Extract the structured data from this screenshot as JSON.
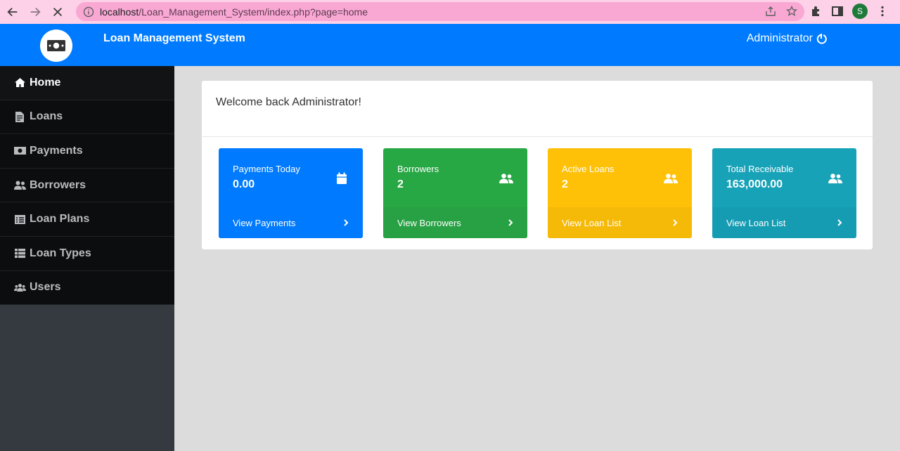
{
  "browser": {
    "url_host": "localhost",
    "url_path": "/Loan_Management_System/index.php?page=home",
    "profile_initial": "S"
  },
  "header": {
    "title": "Loan Management System",
    "user": "Administrator"
  },
  "sidebar": {
    "items": [
      {
        "label": "Home",
        "icon": "home-icon"
      },
      {
        "label": "Loans",
        "icon": "file-invoice-icon"
      },
      {
        "label": "Payments",
        "icon": "money-bill-icon"
      },
      {
        "label": "Borrowers",
        "icon": "user-friends-icon"
      },
      {
        "label": "Loan Plans",
        "icon": "list-alt-icon"
      },
      {
        "label": "Loan Types",
        "icon": "th-list-icon"
      },
      {
        "label": "Users",
        "icon": "users-icon"
      }
    ]
  },
  "main": {
    "welcome": "Welcome back Administrator!",
    "tiles": [
      {
        "label": "Payments Today",
        "value": "0.00",
        "link": "View Payments",
        "color": "#007bff",
        "footer_color": "#007bff",
        "icon": "calendar-icon"
      },
      {
        "label": "Borrowers",
        "value": "2",
        "link": "View Borrowers",
        "color": "#28a745",
        "footer_color": "#27a143",
        "icon": "user-friends-icon"
      },
      {
        "label": "Active Loans",
        "value": "2",
        "link": "View Loan List",
        "color": "#ffc107",
        "footer_color": "#f5b907",
        "icon": "user-friends-icon"
      },
      {
        "label": "Total Receivable",
        "value": "163,000.00",
        "link": "View Loan List",
        "color": "#17a2b8",
        "footer_color": "#169cb2",
        "icon": "user-friends-icon"
      }
    ]
  }
}
